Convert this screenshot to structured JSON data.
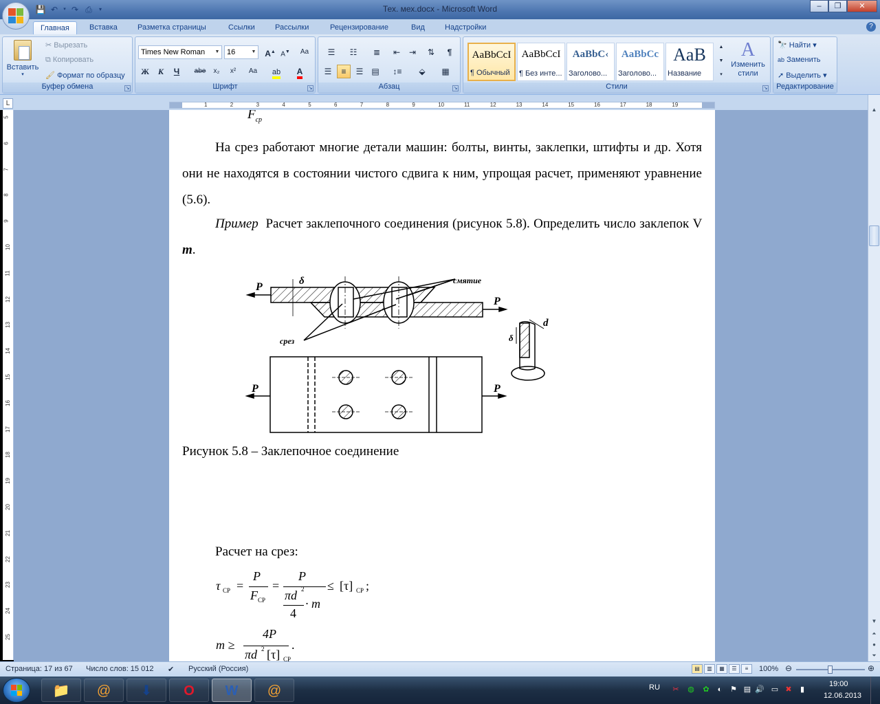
{
  "window": {
    "title": "Тех. мех.docx - Microsoft Word"
  },
  "ribbon_tabs": [
    "Главная",
    "Вставка",
    "Разметка страницы",
    "Ссылки",
    "Рассылки",
    "Рецензирование",
    "Вид",
    "Надстройки"
  ],
  "clipboard": {
    "paste": "Вставить",
    "cut": "Вырезать",
    "copy": "Копировать",
    "format_painter": "Формат по образцу",
    "label": "Буфер обмена"
  },
  "font": {
    "name": "Times New Roman",
    "size": "16",
    "label": "Шрифт",
    "bold": "Ж",
    "italic": "К",
    "underline": "Ч",
    "strike": "abe",
    "subscript": "x₂",
    "superscript": "x²",
    "case": "Aa"
  },
  "paragraph": {
    "label": "Абзац"
  },
  "styles": {
    "label": "Стили",
    "items": [
      {
        "sample": "AaBbCcI",
        "name": "¶ Обычный"
      },
      {
        "sample": "AaBbCcI",
        "name": "¶ Без инте..."
      },
      {
        "sample": "AaBbC‹",
        "name": "Заголово..."
      },
      {
        "sample": "AaBbCc",
        "name": "Заголово..."
      },
      {
        "sample": "AaB",
        "name": "Название"
      }
    ],
    "change": "Изменить стили"
  },
  "editing": {
    "find": "Найти",
    "replace": "Заменить",
    "select": "Выделить",
    "label": "Редактирование"
  },
  "ruler_numbers": [
    "1",
    "2",
    "3",
    "4",
    "5",
    "6",
    "7",
    "8",
    "9",
    "10",
    "11",
    "12",
    "13",
    "14",
    "15",
    "16",
    "17",
    "18",
    "19"
  ],
  "vruler_numbers": [
    "5",
    "6",
    "7",
    "8",
    "9",
    "10",
    "11",
    "12",
    "13",
    "14",
    "15",
    "16",
    "17",
    "18",
    "19",
    "20",
    "21",
    "22",
    "23",
    "24",
    "25"
  ],
  "document": {
    "top_formula_fragment": "F",
    "top_formula_sub": "ср",
    "para1": "На срез работают многие детали машин: болты, винты, заклепки, штифты и др. Хотя они не находятся в состоянии чистого сдвига к ним, упрощая расчет, применяют уравнение (5.6).",
    "example_word": "Пример",
    "para2": "Расчет заклепочного соединения (рисунок 5.8). Определить число заклепок V",
    "para2_var": "m",
    "fig_labels": {
      "P": "P",
      "delta": "δ",
      "d": "d",
      "crush": "смятие",
      "shear": "срез"
    },
    "caption": "Рисунок 5.8 – Заклепочное соединение",
    "shear_calc": "Расчет на срез:",
    "formula1": {
      "tau": "τ",
      "sub_cp": "СР",
      "P": "P",
      "F": "F",
      "pi_d": "πd",
      "sq": "2",
      "four": "4",
      "m": "· m",
      "le": "≤",
      "bracket": "[τ]",
      "semi": ";"
    },
    "formula2": {
      "m": "m ≥",
      "num": "4P",
      "den": "πd",
      "den_tail": "[τ]",
      "sub": "СР",
      "dot": "."
    }
  },
  "status": {
    "page": "Страница: 17 из 67",
    "words": "Число слов: 15 012",
    "lang": "Русский (Россия)",
    "zoom": "100%"
  },
  "taskbar": {
    "lang": "RU",
    "time": "19:00",
    "date": "12.06.2013"
  },
  "colors": {
    "accent": "#15428b",
    "ribbon_bg": "#c9dbf1",
    "doc_bg": "#8fa9cf"
  }
}
